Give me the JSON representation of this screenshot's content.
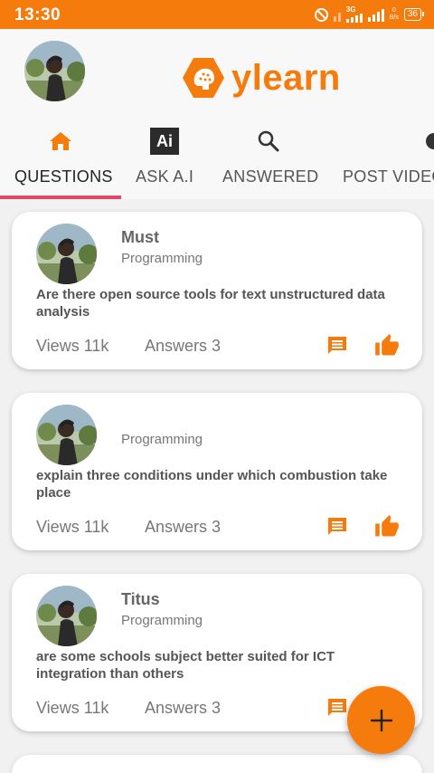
{
  "status_bar": {
    "time": "13:30",
    "network": "3G",
    "speed_value": "0",
    "speed_unit": "B/s",
    "battery": "36"
  },
  "header": {
    "logo_text": "ylearn"
  },
  "tabs": [
    {
      "label": "QUESTIONS",
      "icon": "home-icon",
      "active": true
    },
    {
      "label": "ASK A.I",
      "icon": "ai-icon",
      "icon_text": "Ai",
      "active": false
    },
    {
      "label": "ANSWERED",
      "icon": "search-icon",
      "active": false
    },
    {
      "label": "POST VIDEO",
      "icon": "video-icon",
      "active": false
    }
  ],
  "questions": [
    {
      "author": "Must",
      "category": "Programming",
      "question": "Are there open source tools for text unstructured data analysis",
      "views": "Views 11k",
      "answers": "Answers 3"
    },
    {
      "author": "",
      "category": "Programming",
      "question": "explain three conditions under which combustion take place",
      "views": "Views 11k",
      "answers": "Answers 3"
    },
    {
      "author": "Titus",
      "category": "Programming",
      "question": "are some schools subject better suited for ICT integration than others",
      "views": "Views 11k",
      "answers": "Answers 3"
    }
  ],
  "colors": {
    "brand": "#f47b0c",
    "tab_indicator": "#e0486a"
  }
}
